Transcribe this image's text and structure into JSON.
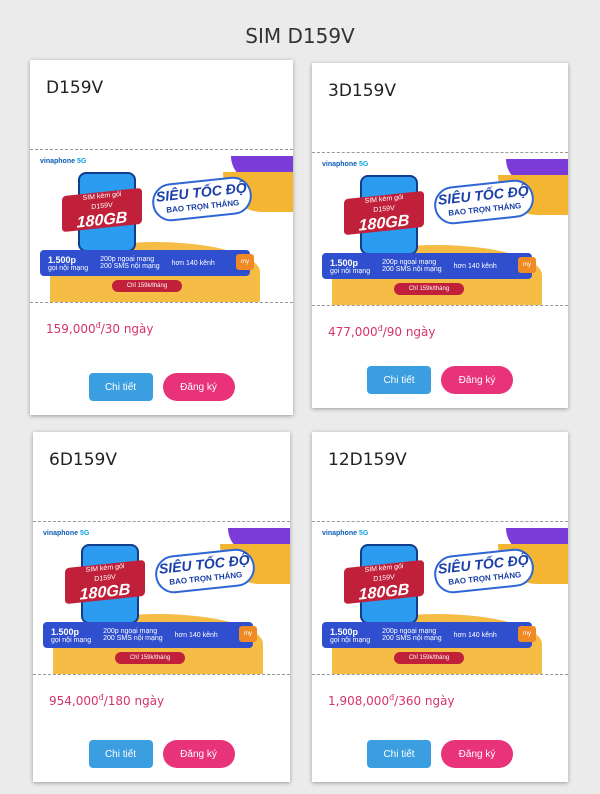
{
  "page": {
    "title": "SIM D159V"
  },
  "banner": {
    "brand": "vinaphone",
    "brand_suffix": "5G",
    "ribbon_small": "SIM kèm gói",
    "ribbon_name": "D159V",
    "ribbon_data": "180GB",
    "headline_1": "SIÊU TỐC ĐỘ",
    "headline_2": "BAO TRỌN THÁNG",
    "stripe_calls": "1.500p",
    "stripe_calls_sub": "gọi nội mạng",
    "stripe_ext": "200p ngoại mạng",
    "stripe_sms": "200 SMS nội mạng",
    "stripe_tv": "hơn 140 kênh",
    "mytv": "my",
    "price_badge": "Chỉ 159k/tháng"
  },
  "cards": [
    {
      "name": "D159V",
      "price": "159,000",
      "currency": "đ",
      "period": "/30 ngày",
      "detail_label": "Chi tiết",
      "register_label": "Đăng ký"
    },
    {
      "name": "3D159V",
      "price": "477,000",
      "currency": "đ",
      "period": "/90 ngày",
      "detail_label": "Chi tiết",
      "register_label": "Đăng ký"
    },
    {
      "name": "6D159V",
      "price": "954,000",
      "currency": "đ",
      "period": "/180 ngày",
      "detail_label": "Chi tiết",
      "register_label": "Đăng ký"
    },
    {
      "name": "12D159V",
      "price": "1,908,000",
      "currency": "đ",
      "period": "/360 ngày",
      "detail_label": "Chi tiết",
      "register_label": "Đăng ký"
    }
  ]
}
